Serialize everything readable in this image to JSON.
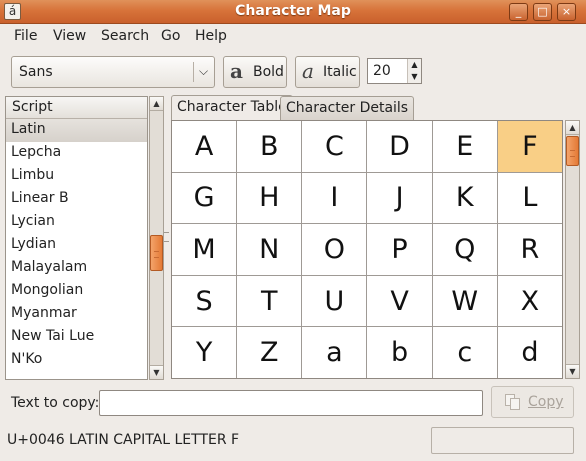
{
  "window": {
    "title": "Character Map",
    "controls": [
      "_",
      "□",
      "×"
    ]
  },
  "menu": [
    "File",
    "View",
    "Search",
    "Go",
    "Help"
  ],
  "toolbar": {
    "font_value": "Sans",
    "bold_label": "Bold",
    "italic_label": "Italic",
    "size_value": "20"
  },
  "script_list": {
    "header": "Script",
    "items": [
      "Latin",
      "Lepcha",
      "Limbu",
      "Linear B",
      "Lycian",
      "Lydian",
      "Malayalam",
      "Mongolian",
      "Myanmar",
      "New Tai Lue",
      "N'Ko"
    ],
    "selected": "Latin"
  },
  "tabs": [
    "Character Table",
    "Character Details"
  ],
  "characters": [
    "A",
    "B",
    "C",
    "D",
    "E",
    "F",
    "G",
    "H",
    "I",
    "J",
    "K",
    "L",
    "M",
    "N",
    "O",
    "P",
    "Q",
    "R",
    "S",
    "T",
    "U",
    "V",
    "W",
    "X",
    "Y",
    "Z",
    "a",
    "b",
    "c",
    "d"
  ],
  "selected_character": "F",
  "copy": {
    "label": "Text to copy:",
    "value": "",
    "button_label": "Copy"
  },
  "status": {
    "text": "U+0046 LATIN CAPITAL LETTER F"
  },
  "colors": {
    "titlebar": "#d7733a",
    "selection": "#f9cf86",
    "scroll_thumb": "#e47a36"
  }
}
